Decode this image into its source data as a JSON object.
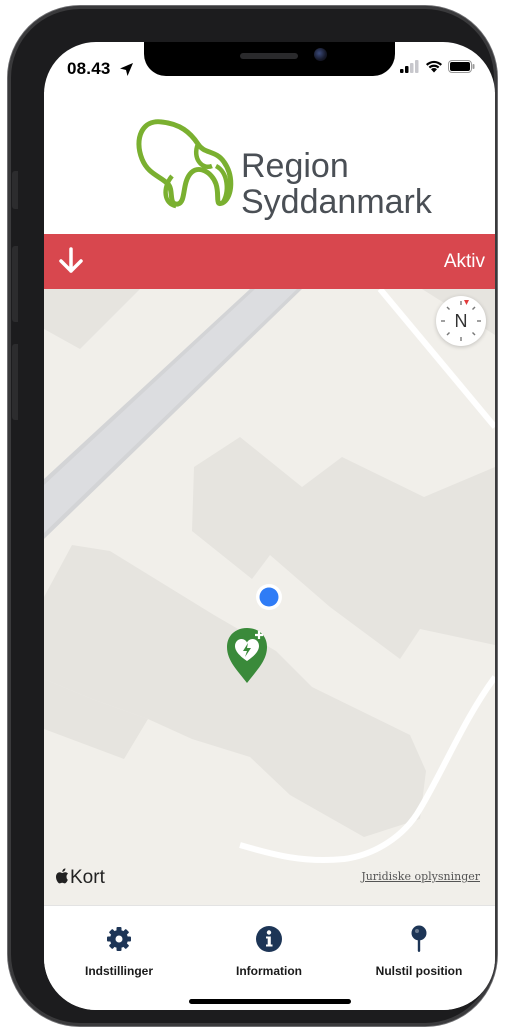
{
  "status_bar": {
    "time": "08.43",
    "location_icon": "location-arrow-icon",
    "signal_icon": "cellular-signal-icon",
    "wifi_icon": "wifi-icon",
    "battery_icon": "battery-icon"
  },
  "header": {
    "logo_line1": "Region",
    "logo_line2": "Syddanmark",
    "logo_icon": "region-syddanmark-logo"
  },
  "status_banner": {
    "arrow_icon": "arrow-down-icon",
    "label": "Aktiv",
    "color": "#d8474e"
  },
  "map": {
    "compass_label": "N",
    "attribution": "Kort",
    "legal_link": "Juridiske oplysninger",
    "user_location_color": "#2f7cf6",
    "aed_marker_icon": "aed-heart-pin-icon",
    "aed_marker_color": "#3a8a3a"
  },
  "tab_bar": {
    "tabs": [
      {
        "label": "Indstillinger",
        "icon": "gear-icon"
      },
      {
        "label": "Information",
        "icon": "info-icon"
      },
      {
        "label": "Nulstil position",
        "icon": "pin-icon"
      }
    ]
  }
}
